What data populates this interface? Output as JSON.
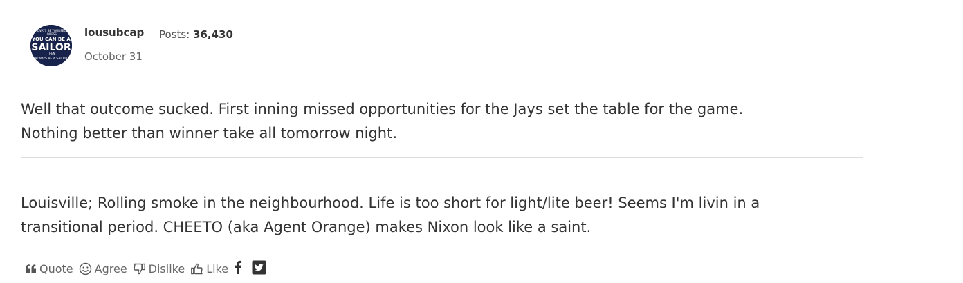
{
  "post": {
    "author": "lousubcap",
    "posts_label": "Posts:",
    "posts_count": "36,430",
    "date": "October 31",
    "avatar_text": {
      "line1": "ALWAYS BE YOURSELF",
      "line2": "UNLESS",
      "line3": "YOU CAN BE A",
      "line4": "SAILOR",
      "line5": "THEN",
      "line6": "ALWAYS BE A SAILOR"
    },
    "body_lines": [
      "Well that outcome sucked.  First inning missed opportunities for the Jays set the table for the game.",
      "Nothing better than winner take all tomorrow night."
    ],
    "signature_lines": [
      "Louisville; Rolling smoke in the neighbourhood.  Life is too short for light/lite beer!  Seems I'm livin in a",
      "transitional period. CHEETO (aka Agent Orange) makes Nixon look like a saint."
    ]
  },
  "reactions": {
    "quote": "Quote",
    "agree": "Agree",
    "dislike": "Dislike",
    "like": "Like"
  },
  "icons": {
    "quote": "quote-icon",
    "agree": "smiley-icon",
    "dislike": "thumbs-down-icon",
    "like": "thumbs-up-icon",
    "facebook": "facebook-icon",
    "twitter": "twitter-icon"
  },
  "colors": {
    "avatar_bg": "#17234a",
    "text": "#333333",
    "muted": "#666666",
    "divider": "#dddddd"
  }
}
